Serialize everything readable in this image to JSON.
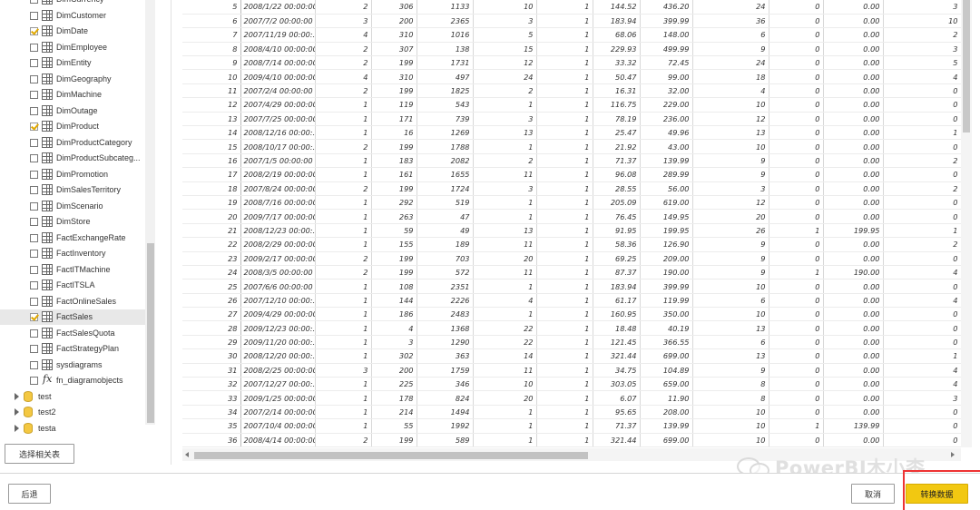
{
  "navigator": {
    "items": [
      {
        "label": "DimCurrency",
        "checked": false,
        "kind": "table"
      },
      {
        "label": "DimCustomer",
        "checked": false,
        "kind": "table"
      },
      {
        "label": "DimDate",
        "checked": true,
        "kind": "table"
      },
      {
        "label": "DimEmployee",
        "checked": false,
        "kind": "table"
      },
      {
        "label": "DimEntity",
        "checked": false,
        "kind": "table"
      },
      {
        "label": "DimGeography",
        "checked": false,
        "kind": "table"
      },
      {
        "label": "DimMachine",
        "checked": false,
        "kind": "table"
      },
      {
        "label": "DimOutage",
        "checked": false,
        "kind": "table"
      },
      {
        "label": "DimProduct",
        "checked": true,
        "kind": "table"
      },
      {
        "label": "DimProductCategory",
        "checked": false,
        "kind": "table"
      },
      {
        "label": "DimProductSubcateg...",
        "checked": false,
        "kind": "table"
      },
      {
        "label": "DimPromotion",
        "checked": false,
        "kind": "table"
      },
      {
        "label": "DimSalesTerritory",
        "checked": false,
        "kind": "table"
      },
      {
        "label": "DimScenario",
        "checked": false,
        "kind": "table"
      },
      {
        "label": "DimStore",
        "checked": false,
        "kind": "table"
      },
      {
        "label": "FactExchangeRate",
        "checked": false,
        "kind": "table"
      },
      {
        "label": "FactInventory",
        "checked": false,
        "kind": "table"
      },
      {
        "label": "FactITMachine",
        "checked": false,
        "kind": "table"
      },
      {
        "label": "FactITSLA",
        "checked": false,
        "kind": "table"
      },
      {
        "label": "FactOnlineSales",
        "checked": false,
        "kind": "table"
      },
      {
        "label": "FactSales",
        "checked": true,
        "kind": "table",
        "selected": true
      },
      {
        "label": "FactSalesQuota",
        "checked": false,
        "kind": "table"
      },
      {
        "label": "FactStrategyPlan",
        "checked": false,
        "kind": "table"
      },
      {
        "label": "sysdiagrams",
        "checked": false,
        "kind": "table"
      },
      {
        "label": "fn_diagramobjects",
        "checked": false,
        "kind": "function"
      }
    ],
    "databases": [
      "test",
      "test2",
      "testa"
    ],
    "related_button": "选择相关表"
  },
  "grid": {
    "rows": [
      [
        "5",
        "2008/1/22 00:00:00",
        "2",
        "306",
        "1133",
        "10",
        "1",
        "144.52",
        "436.20",
        "24",
        "0",
        "0.00",
        "3"
      ],
      [
        "6",
        "2007/7/2 00:00:00",
        "3",
        "200",
        "2365",
        "3",
        "1",
        "183.94",
        "399.99",
        "36",
        "0",
        "0.00",
        "10"
      ],
      [
        "7",
        "2007/11/19 00:00:...",
        "4",
        "310",
        "1016",
        "5",
        "1",
        "68.06",
        "148.00",
        "6",
        "0",
        "0.00",
        "2"
      ],
      [
        "8",
        "2008/4/10 00:00:00",
        "2",
        "307",
        "138",
        "15",
        "1",
        "229.93",
        "499.99",
        "9",
        "0",
        "0.00",
        "3"
      ],
      [
        "9",
        "2008/7/14 00:00:00",
        "2",
        "199",
        "1731",
        "12",
        "1",
        "33.32",
        "72.45",
        "24",
        "0",
        "0.00",
        "5"
      ],
      [
        "10",
        "2009/4/10 00:00:00",
        "4",
        "310",
        "497",
        "24",
        "1",
        "50.47",
        "99.00",
        "18",
        "0",
        "0.00",
        "4"
      ],
      [
        "11",
        "2007/2/4 00:00:00",
        "2",
        "199",
        "1825",
        "2",
        "1",
        "16.31",
        "32.00",
        "4",
        "0",
        "0.00",
        "0"
      ],
      [
        "12",
        "2007/4/29 00:00:00",
        "1",
        "119",
        "543",
        "1",
        "1",
        "116.75",
        "229.00",
        "10",
        "0",
        "0.00",
        "0"
      ],
      [
        "13",
        "2007/7/25 00:00:00",
        "1",
        "171",
        "739",
        "3",
        "1",
        "78.19",
        "236.00",
        "12",
        "0",
        "0.00",
        "0"
      ],
      [
        "14",
        "2008/12/16 00:00:...",
        "1",
        "16",
        "1269",
        "13",
        "1",
        "25.47",
        "49.96",
        "13",
        "0",
        "0.00",
        "1"
      ],
      [
        "15",
        "2008/10/17 00:00:...",
        "2",
        "199",
        "1788",
        "1",
        "1",
        "21.92",
        "43.00",
        "10",
        "0",
        "0.00",
        "0"
      ],
      [
        "16",
        "2007/1/5 00:00:00",
        "1",
        "183",
        "2082",
        "2",
        "1",
        "71.37",
        "139.99",
        "9",
        "0",
        "0.00",
        "2"
      ],
      [
        "17",
        "2008/2/19 00:00:00",
        "1",
        "161",
        "1655",
        "11",
        "1",
        "96.08",
        "289.99",
        "9",
        "0",
        "0.00",
        "0"
      ],
      [
        "18",
        "2007/8/24 00:00:00",
        "2",
        "199",
        "1724",
        "3",
        "1",
        "28.55",
        "56.00",
        "3",
        "0",
        "0.00",
        "2"
      ],
      [
        "19",
        "2008/7/16 00:00:00",
        "1",
        "292",
        "519",
        "1",
        "1",
        "205.09",
        "619.00",
        "12",
        "0",
        "0.00",
        "0"
      ],
      [
        "20",
        "2009/7/17 00:00:00",
        "1",
        "263",
        "47",
        "1",
        "1",
        "76.45",
        "149.95",
        "20",
        "0",
        "0.00",
        "0"
      ],
      [
        "21",
        "2008/12/23 00:00:...",
        "1",
        "59",
        "49",
        "13",
        "1",
        "91.95",
        "199.95",
        "26",
        "1",
        "199.95",
        "1"
      ],
      [
        "22",
        "2008/2/29 00:00:00",
        "1",
        "155",
        "189",
        "11",
        "1",
        "58.36",
        "126.90",
        "9",
        "0",
        "0.00",
        "2"
      ],
      [
        "23",
        "2009/2/17 00:00:00",
        "2",
        "199",
        "703",
        "20",
        "1",
        "69.25",
        "209.00",
        "9",
        "0",
        "0.00",
        "0"
      ],
      [
        "24",
        "2008/3/5 00:00:00",
        "2",
        "199",
        "572",
        "11",
        "1",
        "87.37",
        "190.00",
        "9",
        "1",
        "190.00",
        "4"
      ],
      [
        "25",
        "2007/6/6 00:00:00",
        "1",
        "108",
        "2351",
        "1",
        "1",
        "183.94",
        "399.99",
        "10",
        "0",
        "0.00",
        "0"
      ],
      [
        "26",
        "2007/12/10 00:00:...",
        "1",
        "144",
        "2226",
        "4",
        "1",
        "61.17",
        "119.99",
        "6",
        "0",
        "0.00",
        "4"
      ],
      [
        "27",
        "2009/4/29 00:00:00",
        "1",
        "186",
        "2483",
        "1",
        "1",
        "160.95",
        "350.00",
        "10",
        "0",
        "0.00",
        "0"
      ],
      [
        "28",
        "2009/12/23 00:00:...",
        "1",
        "4",
        "1368",
        "22",
        "1",
        "18.48",
        "40.19",
        "13",
        "0",
        "0.00",
        "0"
      ],
      [
        "29",
        "2009/11/20 00:00:...",
        "1",
        "3",
        "1290",
        "22",
        "1",
        "121.45",
        "366.55",
        "6",
        "0",
        "0.00",
        "0"
      ],
      [
        "30",
        "2008/12/20 00:00:...",
        "1",
        "302",
        "363",
        "14",
        "1",
        "321.44",
        "699.00",
        "13",
        "0",
        "0.00",
        "1"
      ],
      [
        "31",
        "2008/2/25 00:00:00",
        "3",
        "200",
        "1759",
        "11",
        "1",
        "34.75",
        "104.89",
        "9",
        "0",
        "0.00",
        "4"
      ],
      [
        "32",
        "2007/12/27 00:00:...",
        "1",
        "225",
        "346",
        "10",
        "1",
        "303.05",
        "659.00",
        "8",
        "0",
        "0.00",
        "4"
      ],
      [
        "33",
        "2009/1/25 00:00:00",
        "1",
        "178",
        "824",
        "20",
        "1",
        "6.07",
        "11.90",
        "8",
        "0",
        "0.00",
        "3"
      ],
      [
        "34",
        "2007/2/14 00:00:00",
        "1",
        "214",
        "1494",
        "1",
        "1",
        "95.65",
        "208.00",
        "10",
        "0",
        "0.00",
        "0"
      ],
      [
        "35",
        "2007/10/4 00:00:00",
        "1",
        "55",
        "1992",
        "1",
        "1",
        "71.37",
        "139.99",
        "10",
        "1",
        "139.99",
        "0"
      ],
      [
        "36",
        "2008/4/14 00:00:00",
        "2",
        "199",
        "589",
        "1",
        "1",
        "321.44",
        "699.00",
        "10",
        "0",
        "0.00",
        "0"
      ]
    ]
  },
  "footer": {
    "back_label": "后退",
    "cancel_label": "取消",
    "transform_label": "转换数据"
  },
  "watermark": {
    "text": "PowerBI木小桼"
  },
  "colors": {
    "accent_yellow": "#f2c811",
    "selected_row": "#e8e8e8",
    "highlight_red": "#e33333"
  }
}
